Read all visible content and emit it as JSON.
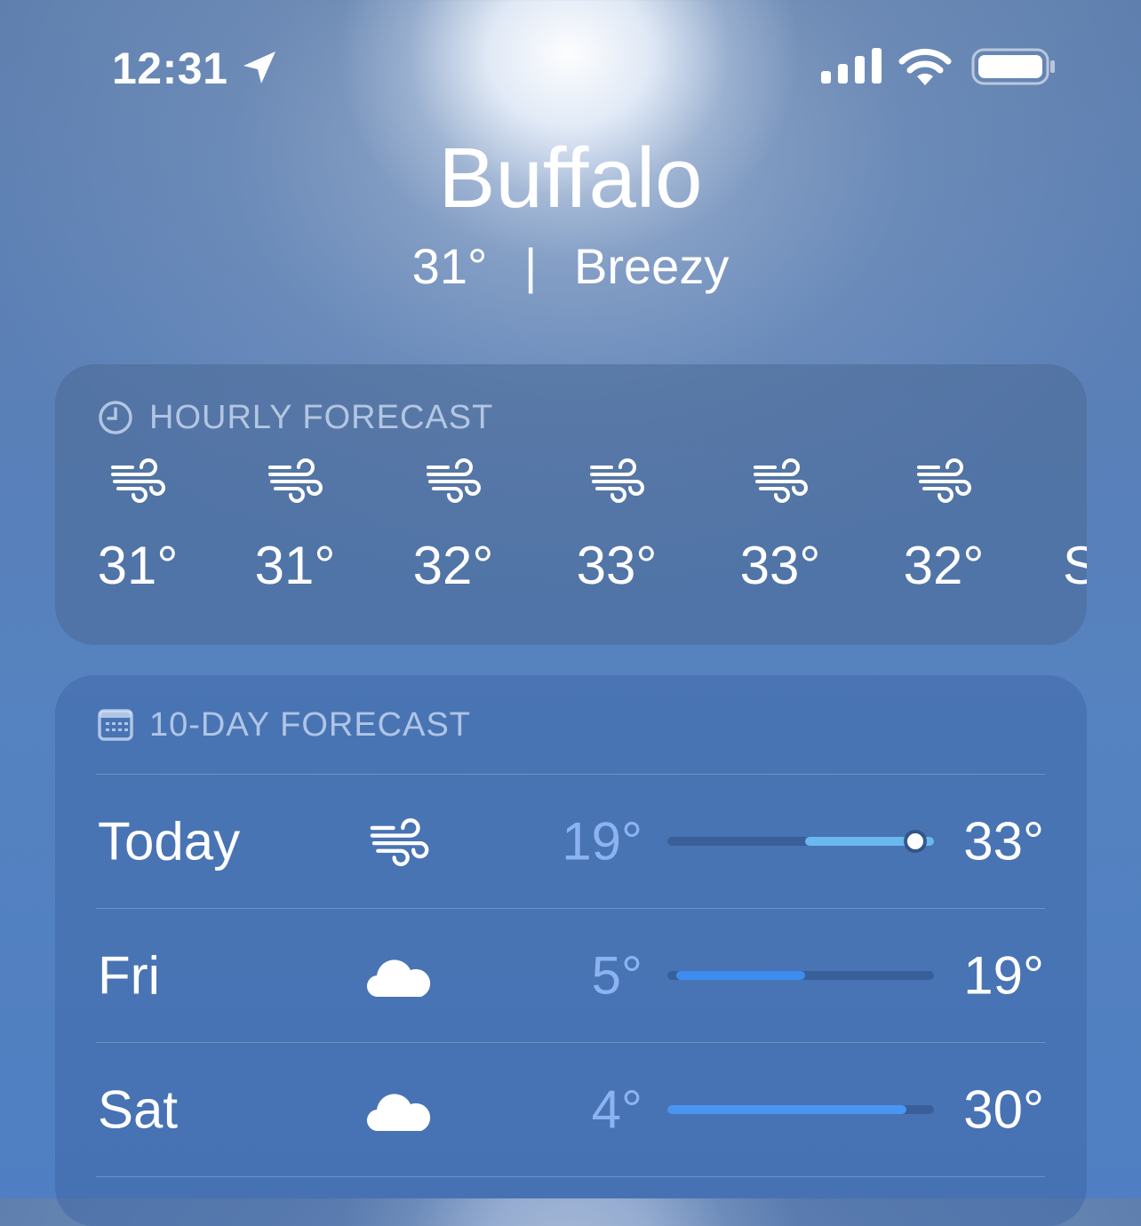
{
  "status_bar": {
    "time": "12:31",
    "icons": [
      "location-arrow-icon",
      "cellular-signal-icon",
      "wifi-icon",
      "battery-icon"
    ]
  },
  "location": {
    "city": "Buffalo",
    "current_temp": "31°",
    "separator": "|",
    "condition": "Breezy"
  },
  "hourly": {
    "header": "HOURLY FORECAST",
    "header_icon": "clock-icon",
    "items": [
      {
        "icon": "wind-icon",
        "temp": "31°"
      },
      {
        "icon": "wind-icon",
        "temp": "31°"
      },
      {
        "icon": "wind-icon",
        "temp": "32°"
      },
      {
        "icon": "wind-icon",
        "temp": "33°"
      },
      {
        "icon": "wind-icon",
        "temp": "33°"
      },
      {
        "icon": "wind-icon",
        "temp": "32°"
      },
      {
        "icon": "",
        "temp": "S"
      }
    ]
  },
  "daily": {
    "header": "10-DAY FORECAST",
    "header_icon": "calendar-icon",
    "range_min": 4,
    "range_max": 33,
    "rows": [
      {
        "day": "Today",
        "icon": "wind-icon",
        "low": "19°",
        "high": "33°",
        "low_value": 19,
        "high_value": 33,
        "current_value": 31,
        "fill_color": "#6ab8f0"
      },
      {
        "day": "Fri",
        "icon": "cloud-icon",
        "low": "5°",
        "high": "19°",
        "low_value": 5,
        "high_value": 19,
        "fill_color": "#3e8cf0"
      },
      {
        "day": "Sat",
        "icon": "cloud-icon",
        "low": "4°",
        "high": "30°",
        "low_value": 4,
        "high_value": 30,
        "fill_color": "#4a94f2"
      }
    ]
  }
}
